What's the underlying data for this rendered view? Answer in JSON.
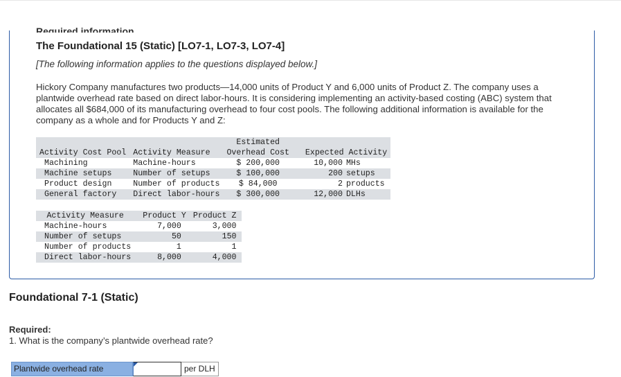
{
  "cut_heading": "Required information",
  "title": "The Foundational 15 (Static) [LO7-1, LO7-3, LO7-4]",
  "subtitle": "[The following information applies to the questions displayed below.]",
  "paragraph": "Hickory Company manufactures two products—14,000 units of Product Y and 6,000 units of Product Z. The company uses a plantwide overhead rate based on direct labor-hours. It is considering implementing an activity-based costing (ABC) system that allocates all $684,000 of its manufacturing overhead to four cost pools. The following additional information is available for the company as a whole and for Products Y and Z:",
  "table1": {
    "headers": {
      "pool": "Activity Cost Pool",
      "measure": "Activity Measure",
      "cost_line1": "Estimated",
      "cost_line2": "Overhead Cost",
      "expected": "Expected Activity"
    },
    "rows": [
      {
        "pool": "Machining",
        "measure": "Machine-hours",
        "cost": "$ 200,000",
        "qty": "10,000",
        "unit": "MHs"
      },
      {
        "pool": "Machine setups",
        "measure": "Number of setups",
        "cost": "$ 100,000",
        "qty": "200",
        "unit": "setups"
      },
      {
        "pool": "Product design",
        "measure": "Number of products",
        "cost": "$ 84,000",
        "qty": "2",
        "unit": "products"
      },
      {
        "pool": "General factory",
        "measure": "Direct labor-hours",
        "cost": "$ 300,000",
        "qty": "12,000",
        "unit": "DLHs"
      }
    ]
  },
  "table2": {
    "headers": {
      "measure": "Activity Measure",
      "y": "Product Y",
      "z": "Product Z"
    },
    "rows": [
      {
        "measure": "Machine-hours",
        "y": "7,000",
        "z": "3,000"
      },
      {
        "measure": "Number of setups",
        "y": "50",
        "z": "150"
      },
      {
        "measure": "Number of products",
        "y": "1",
        "z": "1"
      },
      {
        "measure": "Direct labor-hours",
        "y": "8,000",
        "z": "4,000"
      }
    ]
  },
  "section_title": "Foundational 7-1 (Static)",
  "required_label": "Required:",
  "question": "1. What is the company’s plantwide overhead rate?",
  "answer": {
    "label": "Plantwide overhead rate",
    "value": "",
    "placeholder": "",
    "unit": "per DLH"
  }
}
